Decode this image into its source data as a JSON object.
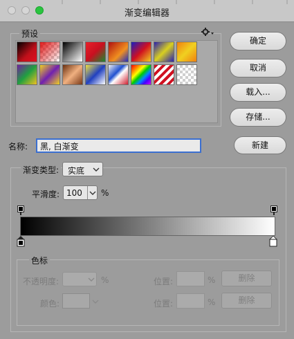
{
  "window": {
    "title": "渐变编辑器"
  },
  "presets": {
    "label": "预设",
    "menu_icon": "gear-icon"
  },
  "buttons": {
    "ok": "确定",
    "cancel": "取消",
    "load": "载入...",
    "save": "存储...",
    "new": "新建"
  },
  "name": {
    "label": "名称:",
    "value": "黑, 白渐变"
  },
  "gradient_type": {
    "label": "渐变类型:",
    "value": "实底"
  },
  "smoothness": {
    "label": "平滑度:",
    "value": "100",
    "unit": "%"
  },
  "color_stops": {
    "label": "色标",
    "opacity_label": "不透明度:",
    "opacity_unit": "%",
    "color_label": "颜色:",
    "location_label": "位置:",
    "location_unit": "%",
    "delete_label": "删除"
  },
  "gradient": {
    "start_color": "#000000",
    "end_color": "#ffffff"
  },
  "colors": {
    "accent_close": "#ff5f57",
    "accent_min": "#c6c6c6",
    "accent_max": "#28c840",
    "name_field_border": "#3b6fd0"
  }
}
